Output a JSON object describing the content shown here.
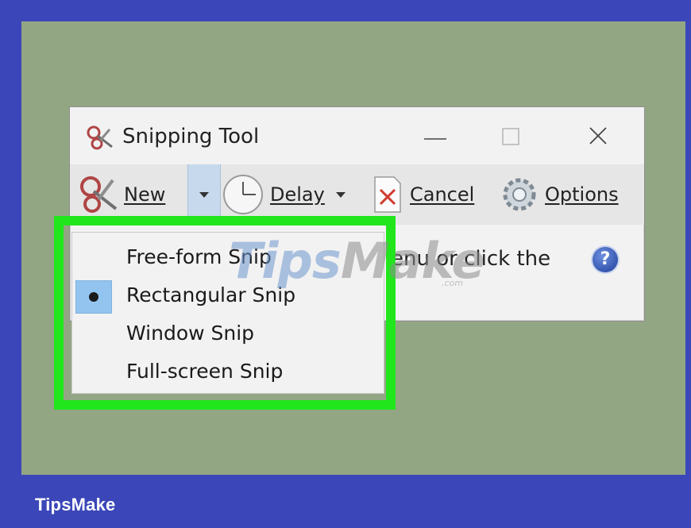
{
  "window": {
    "title": "Snipping Tool",
    "controls": {
      "minimize": "minimize",
      "maximize": "maximize",
      "close": "close"
    }
  },
  "toolbar": {
    "new_label": "New",
    "delay_label": "Delay",
    "cancel_label": "Cancel",
    "options_label": "Options"
  },
  "body": {
    "partial_text": "enu or click the"
  },
  "menu": {
    "items": [
      {
        "label": "Free-form Snip",
        "selected": false
      },
      {
        "label": "Rectangular Snip",
        "selected": true
      },
      {
        "label": "Window Snip",
        "selected": false
      },
      {
        "label": "Full-screen Snip",
        "selected": false
      }
    ]
  },
  "watermark": {
    "part1": "Tips",
    "part2": "Make",
    "suffix": ".com"
  },
  "footer": {
    "brand": "TipsMake"
  },
  "colors": {
    "frame": "#3b47b8",
    "canvas": "#93a684",
    "highlight": "#21e61c",
    "menu_selected": "#93c4ef"
  }
}
